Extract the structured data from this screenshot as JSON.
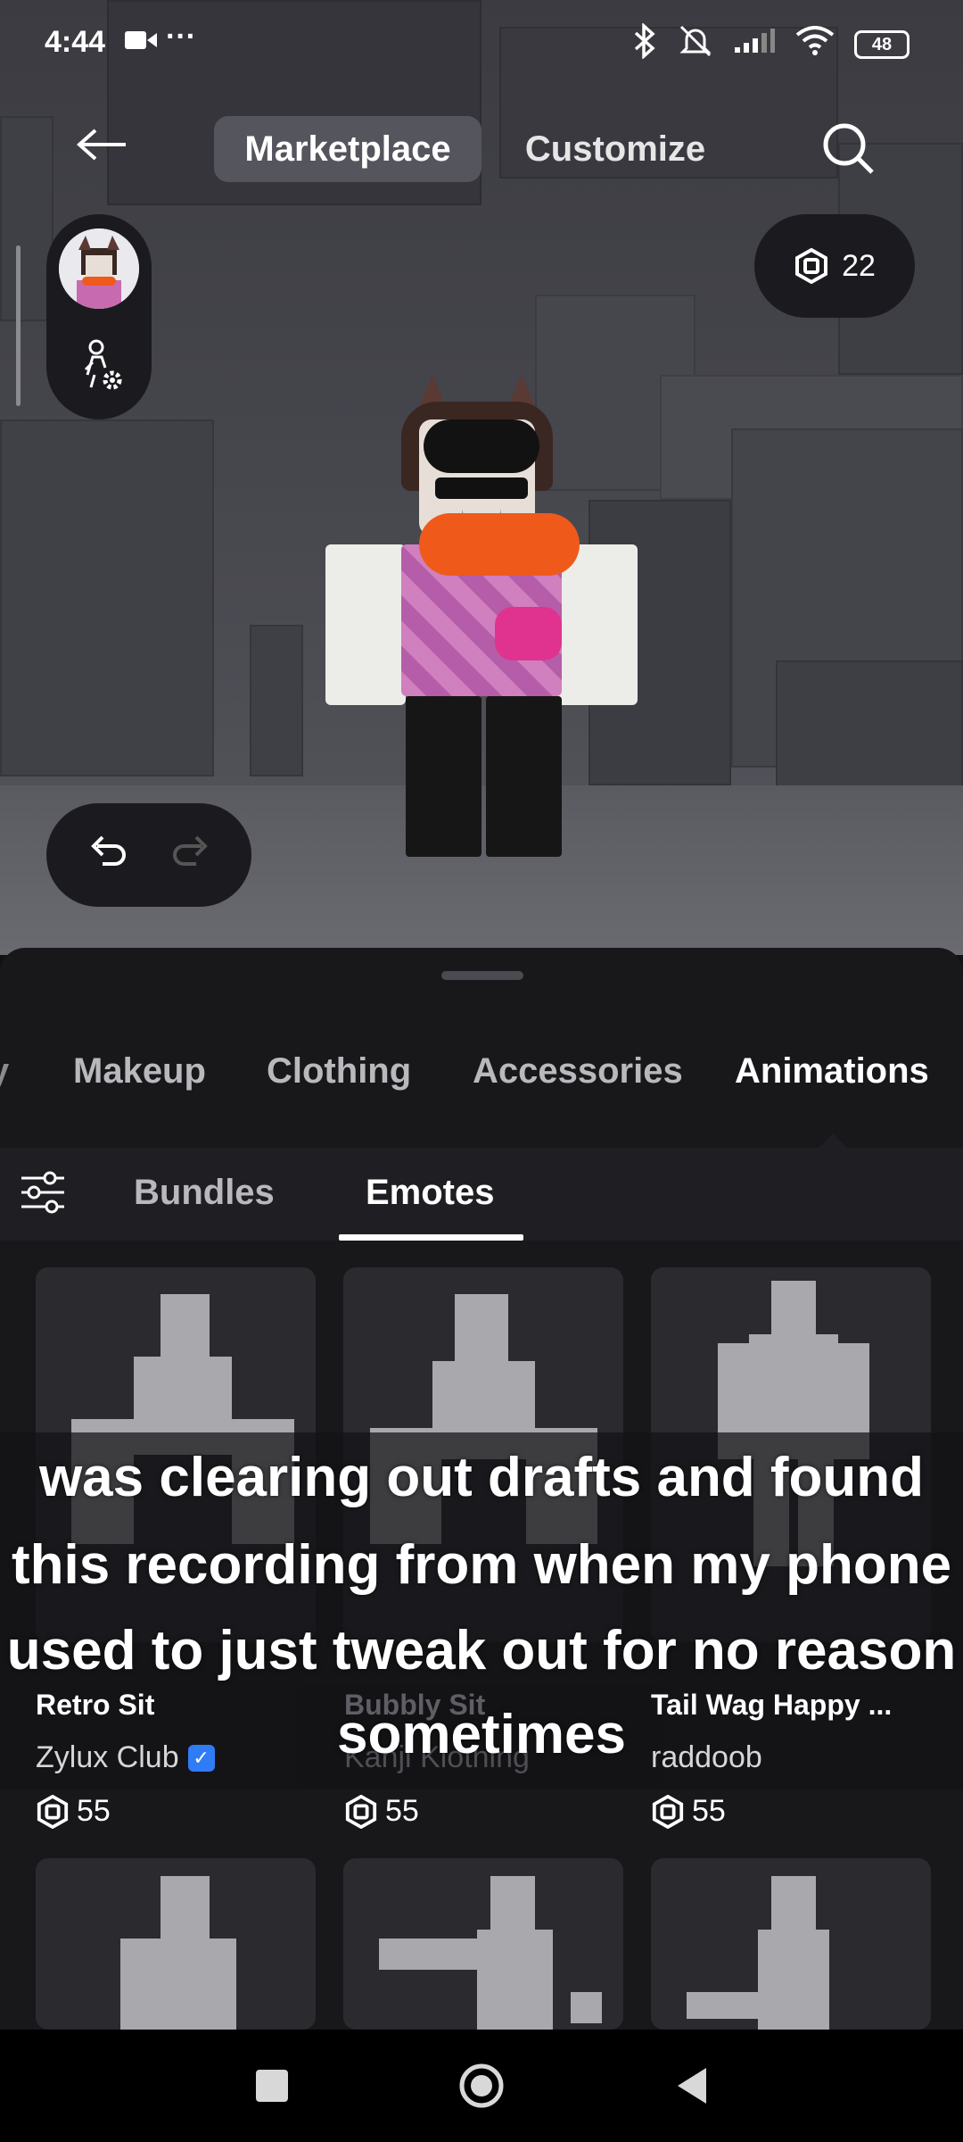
{
  "status_bar": {
    "time": "4:44",
    "dots": "···",
    "battery": "48"
  },
  "header": {
    "tabs": [
      "Marketplace",
      "Customize"
    ],
    "active_tab": "Marketplace"
  },
  "robux_balance": "22",
  "categories": [
    "y",
    "Makeup",
    "Clothing",
    "Accessories",
    "Animations"
  ],
  "active_category": "Animations",
  "subtabs": [
    "Bundles",
    "Emotes"
  ],
  "active_subtab": "Emotes",
  "items": [
    {
      "name": "Retro Sit",
      "creator": "Zylux Club",
      "verified": true,
      "price": "55"
    },
    {
      "name": "Bubbly Sit",
      "creator": "Kanji Klothing",
      "verified": false,
      "price": "55"
    },
    {
      "name": "Tail Wag Happy ...",
      "creator": "raddoob",
      "verified": false,
      "price": "55"
    }
  ],
  "caption": {
    "lines": [
      "was clearing out drafts and found",
      "this recording from when my phone",
      "used to just tweak out for no reason",
      "sometimes"
    ]
  },
  "colors": {
    "background": "#121215",
    "sheet": "#18181b",
    "active_pill": "#55555d",
    "verified": "#2f7cf6"
  },
  "icons": [
    "video-icon",
    "bluetooth-icon",
    "mute-icon",
    "signal-icon",
    "wifi-icon",
    "battery-icon",
    "back-arrow-icon",
    "search-icon",
    "avatar-settings-icon",
    "robux-icon",
    "undo-icon",
    "redo-icon",
    "filter-icon",
    "verified-icon",
    "nav-square-icon",
    "nav-home-icon",
    "nav-back-icon"
  ]
}
